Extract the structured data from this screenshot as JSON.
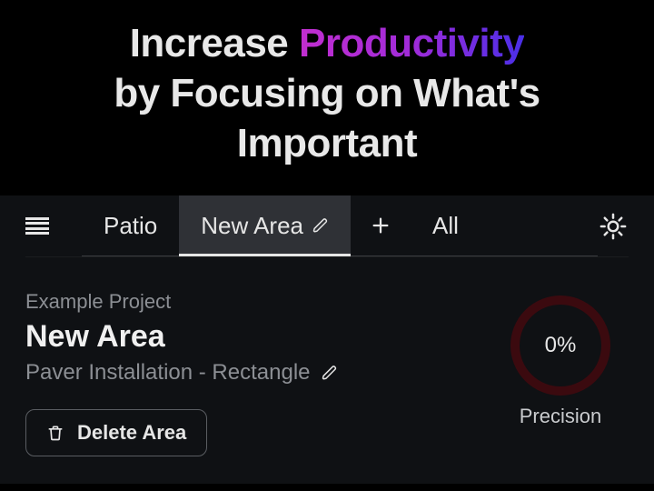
{
  "hero": {
    "line1_pre": "Increase ",
    "line1_highlight": "Productivity",
    "line2": "by Focusing on What's",
    "line3": "Important"
  },
  "tabs": {
    "patio": "Patio",
    "new_area": "New Area",
    "all": "All"
  },
  "content": {
    "project_label": "Example Project",
    "area_title": "New Area",
    "subtitle": "Paver Installation - Rectangle",
    "delete_label": "Delete Area"
  },
  "precision": {
    "value": "0%",
    "label": "Precision"
  }
}
